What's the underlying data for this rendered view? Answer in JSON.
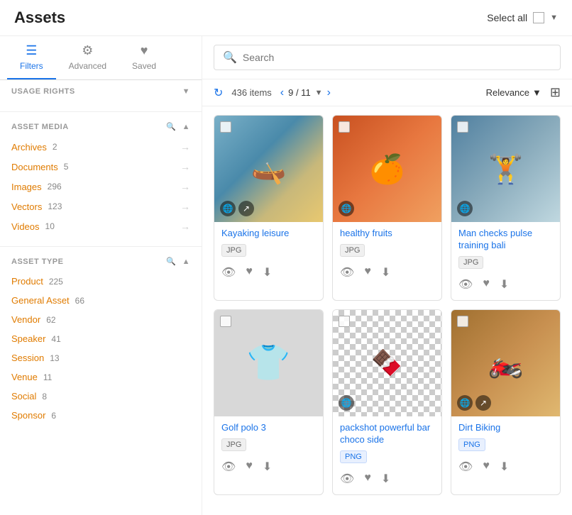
{
  "header": {
    "title": "Assets",
    "select_all_label": "Select all"
  },
  "tabs": [
    {
      "id": "filters",
      "label": "Filters",
      "icon": "☰",
      "active": true
    },
    {
      "id": "advanced",
      "label": "Advanced",
      "icon": "⚙",
      "active": false
    },
    {
      "id": "saved",
      "label": "Saved",
      "icon": "♥",
      "active": false
    }
  ],
  "sidebar": {
    "usage_rights": {
      "label": "USAGE RIGHTS"
    },
    "asset_media": {
      "label": "ASSET MEDIA",
      "items": [
        {
          "name": "Archives",
          "count": "2",
          "class": "archives"
        },
        {
          "name": "Documents",
          "count": "5",
          "class": "documents"
        },
        {
          "name": "Images",
          "count": "296",
          "class": "images"
        },
        {
          "name": "Vectors",
          "count": "123",
          "class": "vectors"
        },
        {
          "name": "Videos",
          "count": "10",
          "class": "videos"
        }
      ]
    },
    "asset_type": {
      "label": "ASSET TYPE",
      "items": [
        {
          "name": "Product",
          "count": "225"
        },
        {
          "name": "General Asset",
          "count": "66"
        },
        {
          "name": "Vendor",
          "count": "62"
        },
        {
          "name": "Speaker",
          "count": "41"
        },
        {
          "name": "Session",
          "count": "13"
        },
        {
          "name": "Venue",
          "count": "11"
        },
        {
          "name": "Social",
          "count": "8"
        },
        {
          "name": "Sponsor",
          "count": "6"
        }
      ]
    }
  },
  "search": {
    "placeholder": "Search"
  },
  "toolbar": {
    "items_count": "436 items",
    "page_info": "9 / 11",
    "sort_label": "Relevance"
  },
  "cards": [
    {
      "id": "card1",
      "title": "Kayaking leisure",
      "tag": "JPG",
      "tag_class": "",
      "has_globe": true,
      "has_share": true,
      "bg_color": "#c8d8e0",
      "image_emoji": "🛶",
      "is_checkerboard": false
    },
    {
      "id": "card2",
      "title": "healthy fruits",
      "tag": "JPG",
      "tag_class": "",
      "has_globe": true,
      "has_share": false,
      "bg_color": "#e8b4a0",
      "image_emoji": "🍊",
      "is_checkerboard": false
    },
    {
      "id": "card3",
      "title": "Man checks pulse training bali",
      "tag": "JPG",
      "tag_class": "",
      "has_globe": true,
      "has_share": false,
      "bg_color": "#a8c0d0",
      "image_emoji": "🏋️",
      "is_checkerboard": false
    },
    {
      "id": "card4",
      "title": "Golf polo 3",
      "tag": "JPG",
      "tag_class": "",
      "has_globe": false,
      "has_share": false,
      "bg_color": "#d8d8d8",
      "image_emoji": "👕",
      "is_checkerboard": false
    },
    {
      "id": "card5",
      "title": "packshot powerful bar choco side",
      "tag": "PNG",
      "tag_class": "png",
      "has_globe": true,
      "has_share": false,
      "bg_color": "",
      "image_emoji": "🍫",
      "is_checkerboard": true
    },
    {
      "id": "card6",
      "title": "Dirt Biking",
      "tag": "PNG",
      "tag_class": "png",
      "has_globe": true,
      "has_share": true,
      "bg_color": "#c8a870",
      "image_emoji": "🏍️",
      "is_checkerboard": false
    }
  ]
}
